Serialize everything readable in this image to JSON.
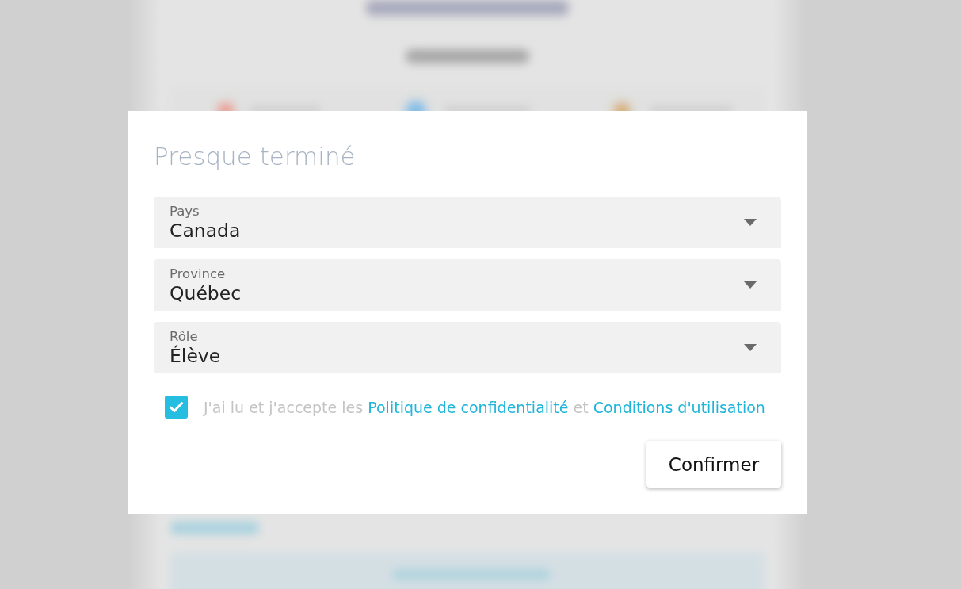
{
  "dialog": {
    "title": "Presque terminé",
    "fields": [
      {
        "label": "Pays",
        "value": "Canada"
      },
      {
        "label": "Province",
        "value": "Québec"
      },
      {
        "label": "Rôle",
        "value": "Élève"
      }
    ],
    "consent": {
      "checked": true,
      "parts": [
        {
          "kind": "text",
          "text": "J'ai lu et j'accepte les"
        },
        {
          "kind": "link",
          "text": "Politique de confidentialité"
        },
        {
          "kind": "text",
          "text": "et"
        },
        {
          "kind": "link",
          "text": "Conditions d'utilisation"
        }
      ]
    },
    "confirm_button": {
      "label": "Confirmer"
    }
  }
}
